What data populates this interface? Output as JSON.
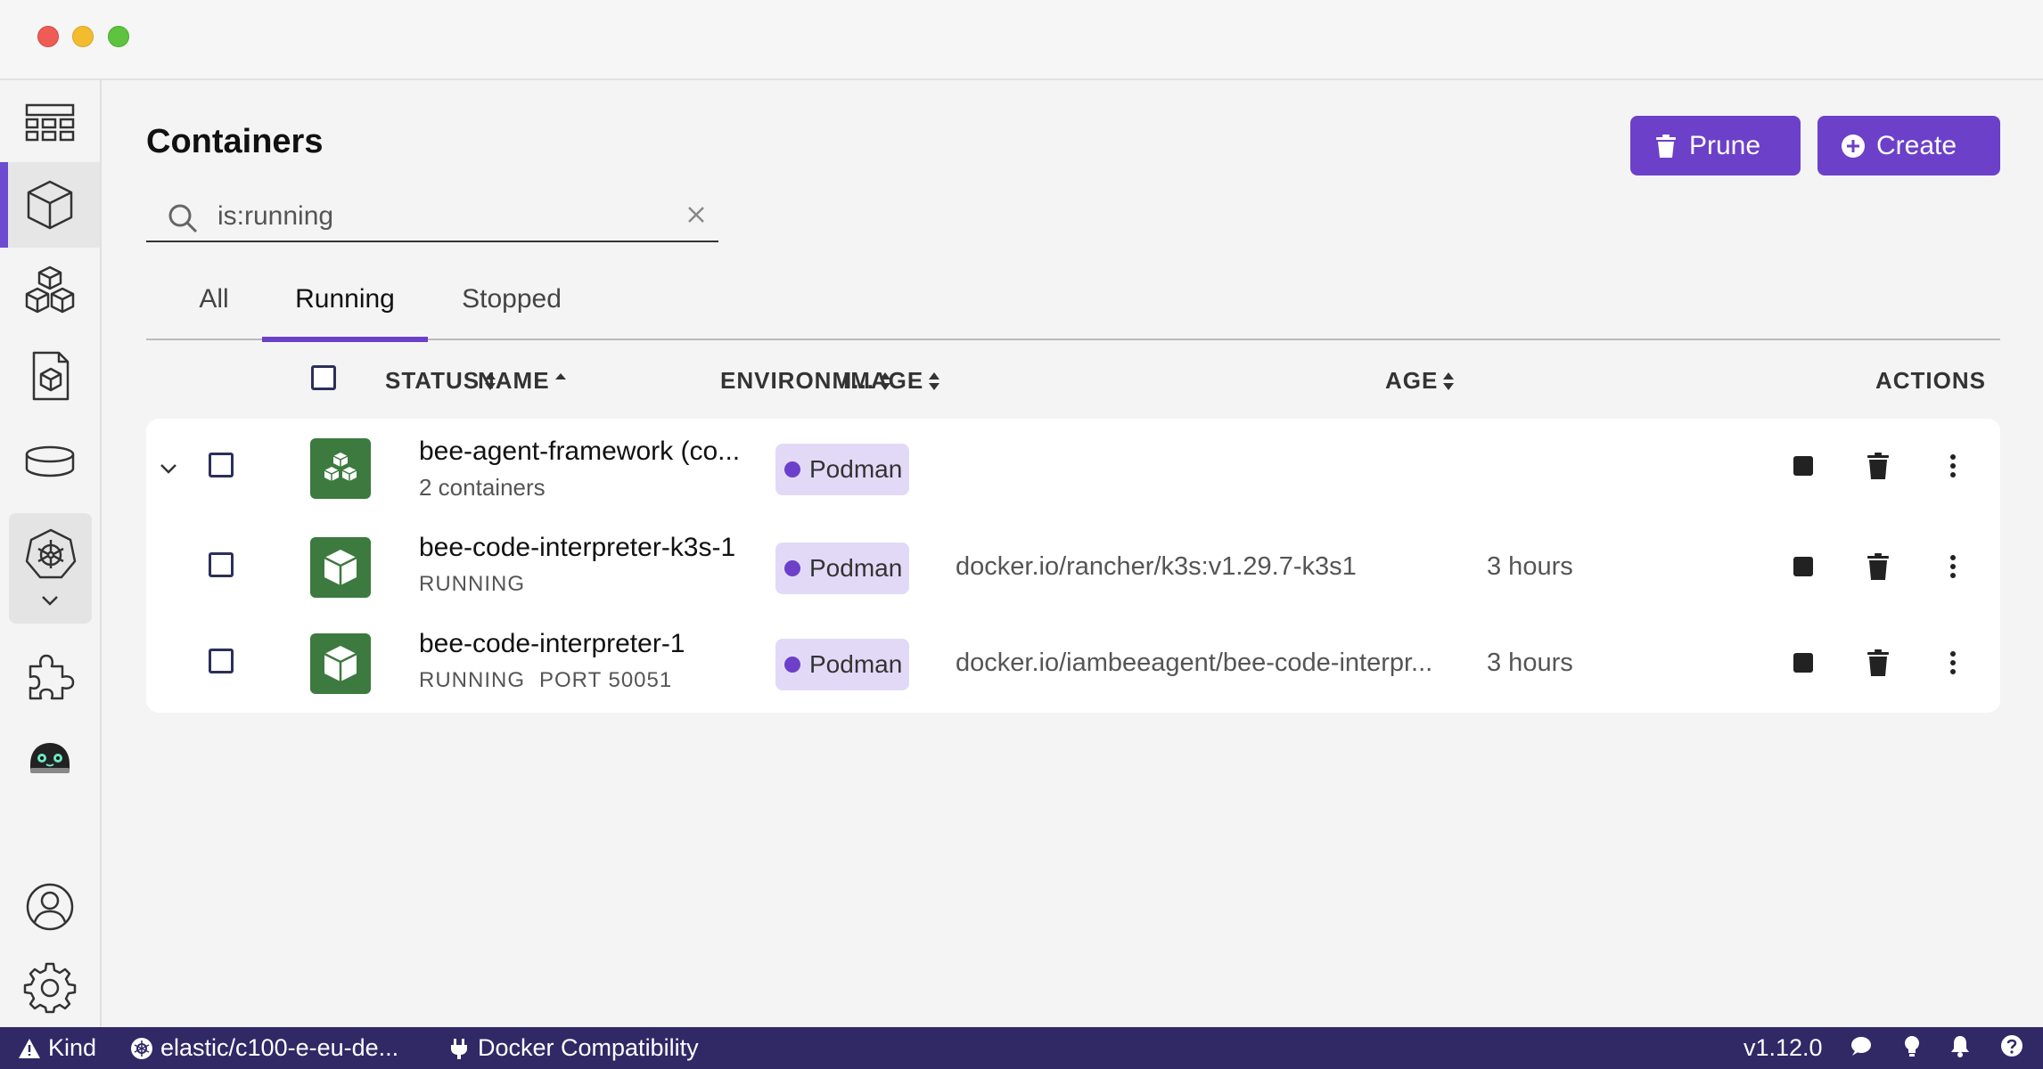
{
  "window": {
    "traffic_lights": [
      "close",
      "minimize",
      "zoom"
    ]
  },
  "sidebar": {
    "items": [
      {
        "icon": "dashboard-icon"
      },
      {
        "icon": "containers-icon",
        "active": true
      },
      {
        "icon": "pods-icon"
      },
      {
        "icon": "images-icon"
      },
      {
        "icon": "volumes-icon"
      },
      {
        "icon": "kubernetes-icon"
      },
      {
        "icon": "extensions-icon"
      },
      {
        "icon": "bee-agent-icon"
      },
      {
        "icon": "account-icon"
      },
      {
        "icon": "settings-icon"
      }
    ]
  },
  "header": {
    "title": "Containers",
    "prune_label": "Prune",
    "create_label": "Create"
  },
  "search": {
    "value": "is:running"
  },
  "tabs": [
    {
      "label": "All",
      "active": false
    },
    {
      "label": "Running",
      "active": true
    },
    {
      "label": "Stopped",
      "active": false
    }
  ],
  "table": {
    "columns": {
      "status": "STATUS",
      "name": "NAME",
      "environment": "ENVIRONM...",
      "image": "IMAGE",
      "age": "AGE",
      "actions": "ACTIONS"
    },
    "rows": [
      {
        "name": "bee-agent-framework (co...",
        "sub": "2 containers",
        "environment": "Podman",
        "image": "",
        "age": "",
        "is_group": true
      },
      {
        "name": "bee-code-interpreter-k3s-1",
        "sub": "RUNNING",
        "environment": "Podman",
        "image": "docker.io/rancher/k3s:v1.29.7-k3s1",
        "age": "3 hours"
      },
      {
        "name": "bee-code-interpreter-1",
        "sub": "RUNNING",
        "port": "PORT 50051",
        "environment": "Podman",
        "image": "docker.io/iambeeagent/bee-code-interpr...",
        "age": "3 hours"
      }
    ]
  },
  "statusbar": {
    "kind": "Kind",
    "context": "elastic/c100-e-eu-de...",
    "docker": "Docker Compatibility",
    "version": "v1.12.0"
  },
  "colors": {
    "accent": "#6c40c9",
    "status_bar": "#312866",
    "running_green": "#3c7a3f",
    "badge_bg": "#e2d9f7"
  }
}
